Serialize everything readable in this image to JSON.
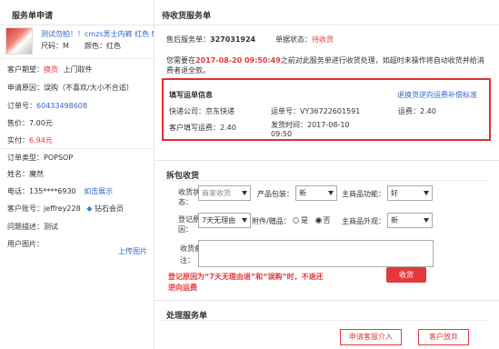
{
  "left": {
    "title": "服务单申请",
    "product": {
      "name": "测试勿拍！！cmzs男士内裤 红色 M",
      "size_label": "尺码：M",
      "color_label": "颜色：红色"
    },
    "expectation": {
      "label": "客户期望：",
      "value": "换货",
      "extra": "上门取件"
    },
    "reason": {
      "label": "申请原因：",
      "value": "误购（不喜欢/大小不合适）"
    },
    "order_no": {
      "label": "订单号：",
      "value": "60433498608"
    },
    "price": {
      "label": "售价：",
      "value": "7.00元"
    },
    "paid": {
      "label": "实付：",
      "value": "6.94元"
    },
    "order_type": {
      "label": "订单类型：",
      "value": "POPSOP"
    },
    "name": {
      "label": "姓名：",
      "value": "魔然"
    },
    "phone": {
      "label": "电话：",
      "value": "135****6930",
      "link": "如击展示"
    },
    "account": {
      "label": "客户账号：",
      "value": "jeffrey228",
      "badge": "钻石会员"
    },
    "problem": {
      "label": "问题描述：",
      "value": "测试"
    },
    "images": {
      "label": "用户图片：",
      "link": "上传图片"
    }
  },
  "right": {
    "title": "待收货服务单",
    "service_no": {
      "label": "售后服务单：",
      "value": "327031924"
    },
    "status": {
      "label": "单据状态：",
      "value": "待收货"
    },
    "notice": {
      "prefix": "您需要在",
      "deadline": "2017-08-20 09:50:49",
      "suffix": "之前对此服务单进行收货处理，如超时未操作将自动收货并给消费者退全款。"
    },
    "waybill": {
      "title": "填写运单信息",
      "link": "退换货逆向运费补偿标准",
      "courier": {
        "label": "快递公司：",
        "value": "京东快递"
      },
      "waybill_no": {
        "label": "运单号：",
        "value": "VY36722601591"
      },
      "fee": {
        "label": "运费：",
        "value": "2.40"
      },
      "customer_fee": {
        "label": "客户填写运费：",
        "value": "2.40"
      },
      "ship_time": {
        "label": "发货时间：",
        "value": "2017-08-10 09:50"
      }
    },
    "receive": {
      "title": "拆包收货",
      "status_label": "收货状",
      "status_label2": "态：",
      "status_value": "商家收货",
      "packaging_label": "产品包装：",
      "packaging_value": "新",
      "function_label": "主商品功能：",
      "function_value": "好",
      "register_label": "登记原",
      "register_label2": "因：",
      "register_value": "7天无理由",
      "accessories_label": "附件/赠品：",
      "radio_yes": "是",
      "radio_no": "否",
      "appearance_label": "主商品外观：",
      "appearance_value": "新",
      "note_label": "收货备",
      "note_label2": "注：",
      "warning_line1": "登记原因为“7天无理由退”和“误购”时，不退还",
      "warning_line2": "逆向运费",
      "receive_button": "收货"
    },
    "process": {
      "title": "处理服务单",
      "intervene_button": "申请客服介入",
      "abandon_button": "客户放弃"
    }
  }
}
